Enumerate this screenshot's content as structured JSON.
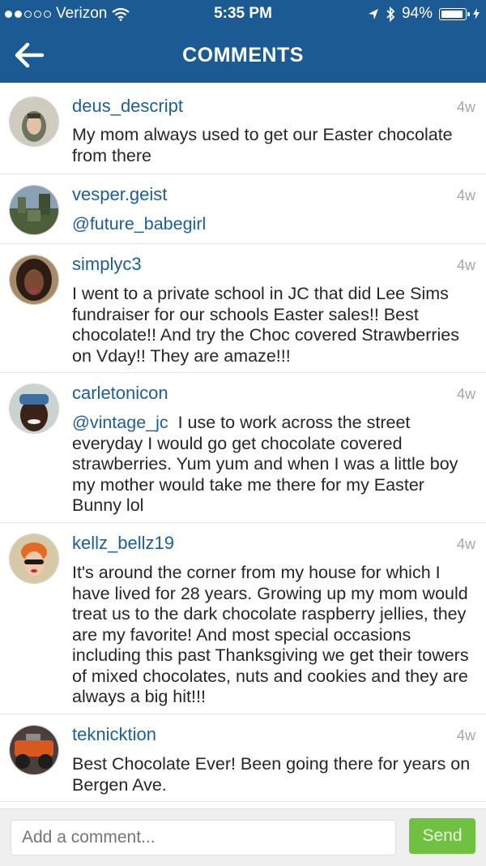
{
  "status_bar": {
    "carrier": "Verizon",
    "time": "5:35 PM",
    "battery": "94%"
  },
  "header": {
    "title": "COMMENTS"
  },
  "comments": [
    {
      "username": "deus_descript",
      "time": "4w",
      "mention": "",
      "text": "My mom always used to get our Easter chocolate from there"
    },
    {
      "username": "vesper.geist",
      "time": "4w",
      "mention": "@future_babegirl",
      "text": ""
    },
    {
      "username": "simplyc3",
      "time": "4w",
      "mention": "",
      "text": "I went to a private school in JC that did Lee Sims fundraiser for our schools Easter sales!! Best chocolate!! And try the Choc covered Strawberries on Vday!! They are amaze!!!"
    },
    {
      "username": "carletonicon",
      "time": "4w",
      "mention": "@vintage_jc",
      "text": "I use to work across the street everyday I would go get chocolate covered strawberries.  Yum yum and when I was a little boy my mother would take me there for my Easter Bunny lol"
    },
    {
      "username": "kellz_bellz19",
      "time": "4w",
      "mention": "",
      "text": "It's around the corner from my house for which I have lived for 28 years. Growing up my mom would treat us to the dark chocolate raspberry jellies, they are my favorite! And most special occasions including this past Thanksgiving we get their towers of mixed chocolates, nuts and cookies and they are always a big hit!!!"
    },
    {
      "username": "teknicktion",
      "time": "4w",
      "mention": "",
      "text": "Best Chocolate Ever! Been going there for years on Bergen Ave."
    }
  ],
  "composer": {
    "placeholder": "Add a comment...",
    "send_label": "Send"
  },
  "colors": {
    "header_bg": "#1b5a92",
    "username": "#1d5f95",
    "send_button": "#70c041"
  }
}
